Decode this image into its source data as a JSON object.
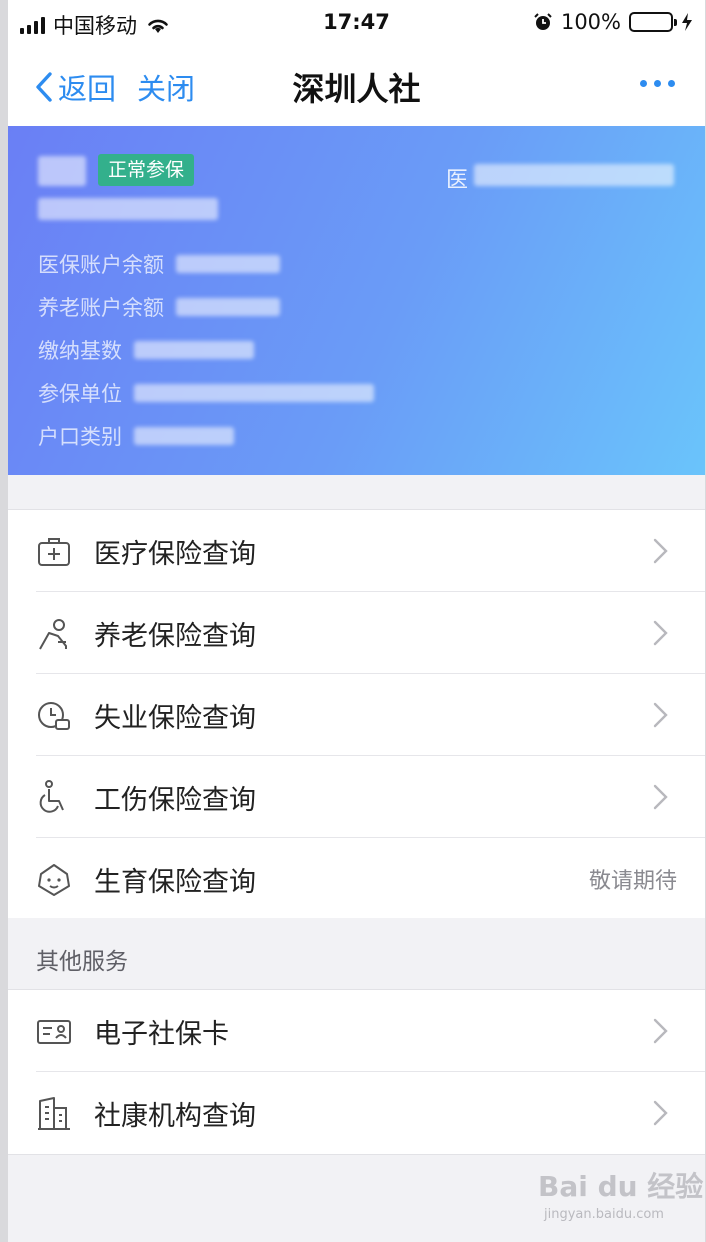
{
  "status_bar": {
    "carrier": "中国移动",
    "time": "17:47",
    "battery": "100%",
    "battery_level": 1.0
  },
  "nav": {
    "back_label": "返回",
    "close_label": "关闭",
    "title": "深圳人社"
  },
  "card": {
    "status_badge": "正常参保",
    "medical_label": "医",
    "fields": [
      {
        "label": "医保账户余额"
      },
      {
        "label": "养老账户余额"
      },
      {
        "label": "缴纳基数"
      },
      {
        "label": "参保单位"
      },
      {
        "label": "户口类别"
      }
    ]
  },
  "insurance_items": [
    {
      "label": "医疗保险查询",
      "icon": "medical-kit-icon"
    },
    {
      "label": "养老保险查询",
      "icon": "elderly-person-icon"
    },
    {
      "label": "失业保险查询",
      "icon": "unemployment-icon"
    },
    {
      "label": "工伤保险查询",
      "icon": "wheelchair-icon"
    },
    {
      "label": "生育保险查询",
      "icon": "baby-face-icon",
      "extra": "敬请期待"
    }
  ],
  "other_services": {
    "header": "其他服务",
    "items": [
      {
        "label": "电子社保卡",
        "icon": "id-card-icon"
      },
      {
        "label": "社康机构查询",
        "icon": "building-icon"
      }
    ]
  },
  "watermark": {
    "text": "Bai du 经验",
    "subtext": "jingyan.baidu.com"
  },
  "colors": {
    "accent": "#2d8cf0",
    "badge": "#33b08c",
    "card_gradient_start": "#6a7ff5",
    "card_gradient_end": "#6ac4fb"
  }
}
